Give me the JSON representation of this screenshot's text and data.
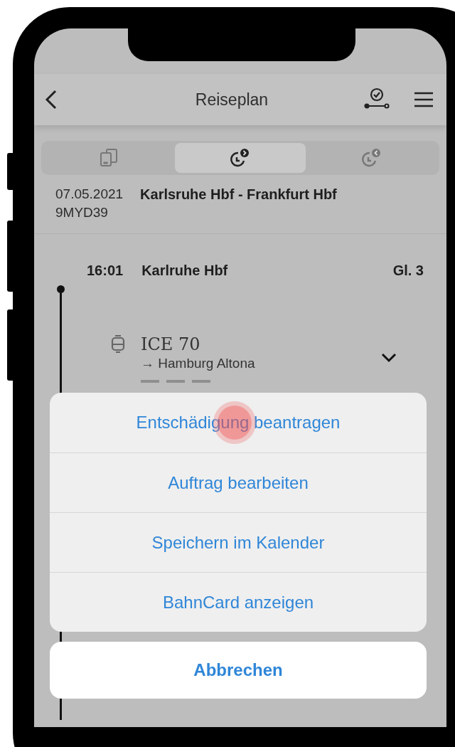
{
  "header": {
    "title": "Reiseplan"
  },
  "tabs": [
    {
      "kind": "ticket",
      "selected": false
    },
    {
      "kind": "outbound",
      "selected": true
    },
    {
      "kind": "return",
      "selected": false
    }
  ],
  "trip": {
    "date": "07.05.2021",
    "code": "9MYD39",
    "route": "Karlsruhe Hbf - Frankfurt Hbf"
  },
  "stop": {
    "time": "16:01",
    "station": "Karlruhe Hbf",
    "platform": "Gl. 3"
  },
  "train": {
    "name": "ICE 70",
    "destination": "→ Hamburg Altona",
    "expanded": false
  },
  "action_sheet": {
    "actions": [
      "Entschädigung beantragen",
      "Auftrag bearbeiten",
      "Speichern im Kalender",
      "BahnCard anzeigen"
    ],
    "cancel": "Abbrechen"
  }
}
